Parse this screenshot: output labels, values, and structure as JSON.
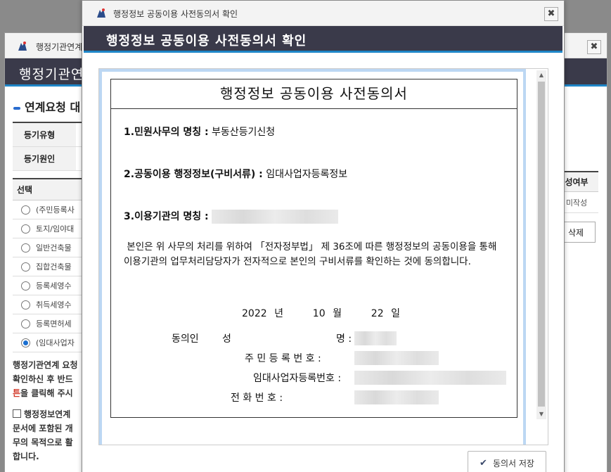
{
  "background_window": {
    "title": "행정기관연계",
    "header_title": "행정기관연",
    "section_title": "연계요청 대",
    "info_rows": [
      {
        "label": "등기유형"
      },
      {
        "label": "등기원인"
      }
    ],
    "list_header": "선택",
    "list_items": [
      {
        "label": "(주민등록사",
        "selected": false
      },
      {
        "label": "토지/임야대",
        "selected": false
      },
      {
        "label": "일반건축물",
        "selected": false
      },
      {
        "label": "집합건축물",
        "selected": false
      },
      {
        "label": "등록세영수",
        "selected": false
      },
      {
        "label": "취득세영수",
        "selected": false
      },
      {
        "label": "등록면허세",
        "selected": false
      },
      {
        "label": "(임대사업자",
        "selected": true
      }
    ],
    "notice_line1": "행정기관연계 요청",
    "notice_line2": "확인하신 후 반드",
    "notice_red": "튼",
    "notice_line3_rest": "을 클릭해 주시",
    "checkbox_notice_line1": "행정정보연계",
    "checkbox_notice_line2": "문서에 포함된 개",
    "checkbox_notice_line3": "무의 목적으로 활",
    "checkbox_notice_line4": "합니다.",
    "right_col_header": "성여부",
    "right_col_value": "미작성",
    "delete_button": "삭제"
  },
  "dialog": {
    "window_title": "행정정보 공동이용 사전동의서 확인",
    "header_title": "행정정보 공동이용 사전동의서 확인",
    "document": {
      "title": "행정정보 공동이용 사전동의서",
      "item1_label": "1.민원사무의 명칭 :",
      "item1_value": "부동산등기신청",
      "item2_label": "2.공동이용 행정정보(구비서류) :",
      "item2_value": "임대사업자등록정보",
      "item3_label": "3.이용기관의 명칭 :",
      "paragraph": "본인은 위 사무의 처리를 위하여 「전자정부법」 제 36조에 따른 행정정보의 공동이용을 통해 이용기관의 업무처리담당자가 전자적으로 본인의 구비서류를 확인하는 것에 동의합니다.",
      "date_year": "2022",
      "date_year_unit": "년",
      "date_month": "10",
      "date_month_unit": "월",
      "date_day": "22",
      "date_day_unit": "일",
      "consenter_label": "동의인",
      "name_label_a": "성",
      "name_label_b": "명 :",
      "resident_label": "주 민   등 록   번 호 :",
      "rental_label": "임대사업자등록번호 :",
      "phone_label": "전      화      번      호 :"
    },
    "save_button": "동의서 저장"
  },
  "colors": {
    "header_bg": "#3a3a4a",
    "header_accent": "#1f86c8",
    "notice_red": "#d23a2a"
  }
}
